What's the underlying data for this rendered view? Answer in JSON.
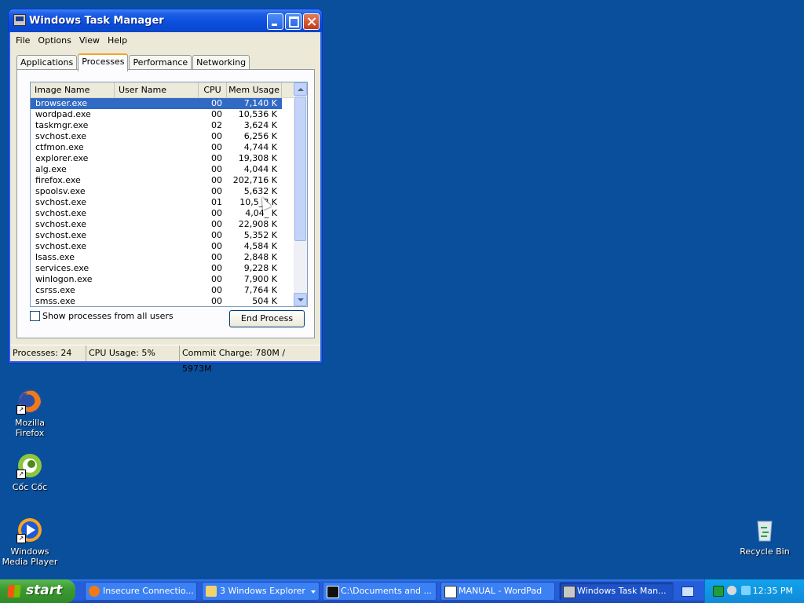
{
  "window": {
    "title": "Windows Task Manager",
    "menu": [
      "File",
      "Options",
      "View",
      "Help"
    ],
    "tabs": [
      "Applications",
      "Processes",
      "Performance",
      "Networking"
    ],
    "active_tab": "Processes",
    "columns": [
      "Image Name",
      "User Name",
      "CPU",
      "Mem Usage"
    ],
    "processes": [
      {
        "name": "browser.exe",
        "user": "",
        "cpu": "00",
        "mem": "7,140 K"
      },
      {
        "name": "wordpad.exe",
        "user": "",
        "cpu": "00",
        "mem": "10,536 K"
      },
      {
        "name": "taskmgr.exe",
        "user": "",
        "cpu": "02",
        "mem": "3,624 K"
      },
      {
        "name": "svchost.exe",
        "user": "",
        "cpu": "00",
        "mem": "6,256 K"
      },
      {
        "name": "ctfmon.exe",
        "user": "",
        "cpu": "00",
        "mem": "4,744 K"
      },
      {
        "name": "explorer.exe",
        "user": "",
        "cpu": "00",
        "mem": "19,308 K"
      },
      {
        "name": "alg.exe",
        "user": "",
        "cpu": "00",
        "mem": "4,044 K"
      },
      {
        "name": "firefox.exe",
        "user": "",
        "cpu": "00",
        "mem": "202,716 K"
      },
      {
        "name": "spoolsv.exe",
        "user": "",
        "cpu": "00",
        "mem": "5,632 K"
      },
      {
        "name": "svchost.exe",
        "user": "",
        "cpu": "01",
        "mem": "10,5_8 K"
      },
      {
        "name": "svchost.exe",
        "user": "",
        "cpu": "00",
        "mem": "4,04_ K"
      },
      {
        "name": "svchost.exe",
        "user": "",
        "cpu": "00",
        "mem": "22,908 K"
      },
      {
        "name": "svchost.exe",
        "user": "",
        "cpu": "00",
        "mem": "5,352 K"
      },
      {
        "name": "svchost.exe",
        "user": "",
        "cpu": "00",
        "mem": "4,584 K"
      },
      {
        "name": "lsass.exe",
        "user": "",
        "cpu": "00",
        "mem": "2,848 K"
      },
      {
        "name": "services.exe",
        "user": "",
        "cpu": "00",
        "mem": "9,228 K"
      },
      {
        "name": "winlogon.exe",
        "user": "",
        "cpu": "00",
        "mem": "7,900 K"
      },
      {
        "name": "csrss.exe",
        "user": "",
        "cpu": "00",
        "mem": "7,764 K"
      },
      {
        "name": "smss.exe",
        "user": "",
        "cpu": "00",
        "mem": "504 K"
      }
    ],
    "selected_index": 0,
    "show_all_label": "Show processes from all users",
    "end_process_label": "End Process",
    "status": {
      "processes": "Processes: 24",
      "cpu": "CPU Usage: 5%",
      "commit": "Commit Charge: 780M / 5973M"
    }
  },
  "desktop_icons": [
    {
      "label": "Mozilla Firefox",
      "icon": "firefox-icon"
    },
    {
      "label": "Cốc Cốc",
      "icon": "coccoc-icon"
    },
    {
      "label": "Windows Media Player",
      "icon": "media-player-icon"
    },
    {
      "label": "Recycle Bin",
      "icon": "recycle-bin-icon"
    }
  ],
  "taskbar": {
    "start_label": "start",
    "tasks": [
      {
        "label": "Insecure Connectio...",
        "icon": "firefox-icon"
      },
      {
        "label": "3 Windows Explorer",
        "icon": "folder-icon"
      },
      {
        "label": "C:\\Documents and ...",
        "icon": "7zip-icon"
      },
      {
        "label": "MANUAL - WordPad",
        "icon": "wordpad-icon"
      },
      {
        "label": "Windows Task Man...",
        "icon": "task-manager-icon"
      }
    ],
    "clock": "12:35 PM"
  },
  "colors": {
    "desktop": "#0a4f9c",
    "selection": "#316ac5",
    "start_green": "#3c9a31"
  }
}
